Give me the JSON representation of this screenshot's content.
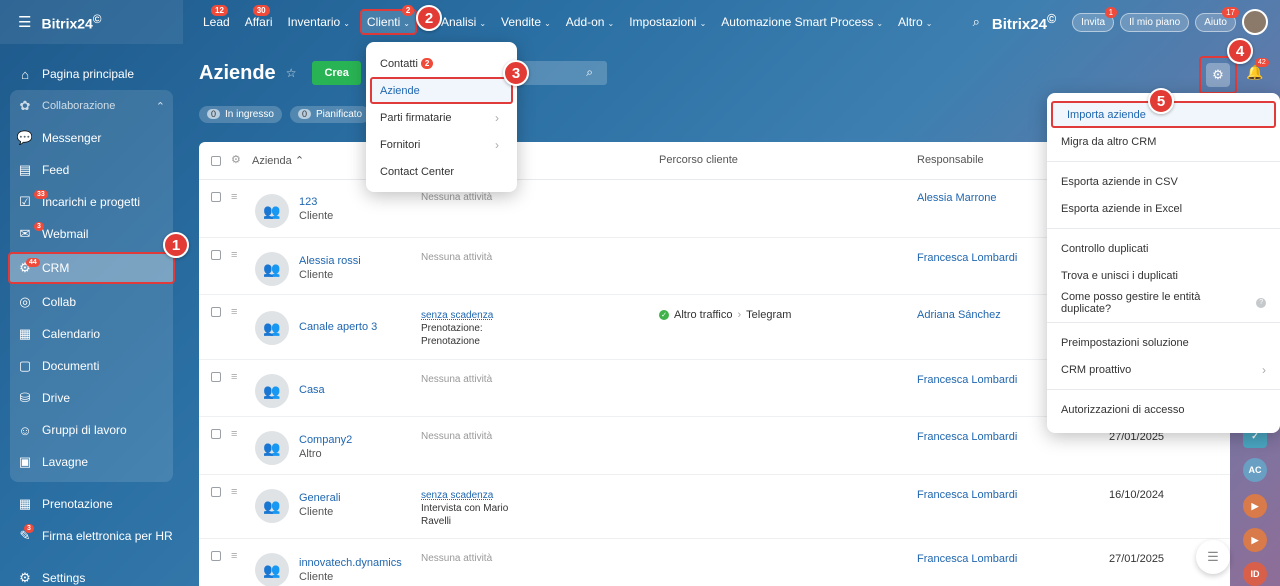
{
  "brand": {
    "name": "Bitrix24",
    "mark": "©"
  },
  "nav": [
    {
      "label": "Lead",
      "badge": "12",
      "caret": ""
    },
    {
      "label": "Affari",
      "badge": "30",
      "caret": ""
    },
    {
      "label": "Inventario",
      "badge": "",
      "caret": "⌄"
    },
    {
      "label": "Clienti",
      "badge": "2",
      "caret": "⌄"
    },
    {
      "label": "Analisi",
      "badge": "",
      "caret": "⌄"
    },
    {
      "label": "Vendite",
      "badge": "",
      "caret": "⌄"
    },
    {
      "label": "Add-on",
      "badge": "",
      "caret": "⌄"
    },
    {
      "label": "Impostazioni",
      "badge": "",
      "caret": "⌄"
    },
    {
      "label": "Automazione Smart Process",
      "badge": "",
      "caret": "⌄"
    },
    {
      "label": "Altro",
      "badge": "",
      "caret": "⌄"
    }
  ],
  "topright": {
    "logo": "Bitrix24",
    "invite": "Invita",
    "invite_badge": "1",
    "plan": "Il mio piano",
    "help": "Aiuto",
    "help_badge": "17"
  },
  "sidebar": {
    "home": "Pagina principale",
    "group": "Collaborazione",
    "items": [
      {
        "label": "Messenger",
        "badge": "",
        "icon": "💬"
      },
      {
        "label": "Feed",
        "badge": "",
        "icon": "▤"
      },
      {
        "label": "Incarichi e progetti",
        "badge": "33",
        "icon": "☑"
      },
      {
        "label": "Webmail",
        "badge": "3",
        "icon": "✉"
      },
      {
        "label": "CRM",
        "badge": "44",
        "icon": "⚙"
      },
      {
        "label": "Collab",
        "badge": "",
        "icon": "◎"
      },
      {
        "label": "Calendario",
        "badge": "",
        "icon": "▦"
      },
      {
        "label": "Documenti",
        "badge": "",
        "icon": "▢"
      },
      {
        "label": "Drive",
        "badge": "",
        "icon": "⛁"
      },
      {
        "label": "Gruppi di lavoro",
        "badge": "",
        "icon": "☺"
      },
      {
        "label": "Lavagne",
        "badge": "",
        "icon": "▣"
      }
    ],
    "extra": [
      {
        "label": "Prenotazione",
        "badge": "",
        "icon": "▦"
      },
      {
        "label": "Firma elettronica per HR",
        "badge": "3",
        "icon": "✎"
      }
    ],
    "settings": "Settings"
  },
  "page": {
    "title": "Aziende",
    "create": "Crea"
  },
  "filters": [
    {
      "count": "0",
      "label": "In ingresso"
    },
    {
      "count": "0",
      "label": "Pianificato"
    }
  ],
  "table": {
    "headers": {
      "company": "Azienda",
      "path": "Percorso cliente",
      "owner": "Responsabile"
    },
    "rows": [
      {
        "name": "123",
        "type": "Cliente",
        "activity": "Nessuna attività",
        "deadline": "",
        "note1": "",
        "note2": "",
        "source": "",
        "channel": "",
        "owner": "Alessia Marrone",
        "date": ""
      },
      {
        "name": "Alessia rossi",
        "type": "Cliente",
        "activity": "Nessuna attività",
        "deadline": "",
        "note1": "",
        "note2": "",
        "source": "",
        "channel": "",
        "owner": "Francesca Lombardi",
        "date": ""
      },
      {
        "name": "Canale aperto 3",
        "type": "",
        "activity": "",
        "deadline": "senza scadenza",
        "note1": "Prenotazione:",
        "note2": "Prenotazione",
        "source": "Altro traffico",
        "channel": "Telegram",
        "owner": "Adriana Sánchez",
        "date": ""
      },
      {
        "name": "Casa",
        "type": "",
        "activity": "Nessuna attività",
        "deadline": "",
        "note1": "",
        "note2": "",
        "source": "",
        "channel": "",
        "owner": "Francesca Lombardi",
        "date": ""
      },
      {
        "name": "Company2",
        "type": "Altro",
        "activity": "Nessuna attività",
        "deadline": "",
        "note1": "",
        "note2": "",
        "source": "",
        "channel": "",
        "owner": "Francesca Lombardi",
        "date": "27/01/2025"
      },
      {
        "name": "Generali",
        "type": "Cliente",
        "activity": "",
        "deadline": "senza scadenza",
        "note1": "Intervista con Mario",
        "note2": "Ravelli",
        "source": "",
        "channel": "",
        "owner": "Francesca Lombardi",
        "date": "16/10/2024"
      },
      {
        "name": "innovatech.dynamics",
        "type": "Cliente",
        "activity": "Nessuna attività",
        "deadline": "",
        "note1": "",
        "note2": "",
        "source": "",
        "channel": "",
        "owner": "Francesca Lombardi",
        "date": "27/01/2025"
      }
    ]
  },
  "clienti_menu": [
    {
      "label": "Contatti",
      "badge": "2",
      "chevron": ""
    },
    {
      "label": "Aziende",
      "badge": "",
      "chevron": ""
    },
    {
      "label": "Parti firmatarie",
      "badge": "",
      "chevron": "›"
    },
    {
      "label": "Fornitori",
      "badge": "",
      "chevron": "›"
    },
    {
      "label": "Contact Center",
      "badge": "",
      "chevron": ""
    }
  ],
  "settings_menu": {
    "g1": [
      "Importa aziende",
      "Migra da altro CRM"
    ],
    "g2": [
      "Esporta aziende in CSV",
      "Esporta aziende in Excel"
    ],
    "g3": [
      "Controllo duplicati",
      "Trova e unisci i duplicati",
      "Come posso gestire le entità duplicate?"
    ],
    "g4": [
      "Preimpostazioni soluzione",
      "CRM proattivo"
    ],
    "g5": [
      "Autorizzazioni di accesso"
    ]
  },
  "bell_badge": "42",
  "rightstrip": [
    "AC",
    "ID"
  ],
  "callouts": [
    "1",
    "2",
    "3",
    "4",
    "5"
  ]
}
